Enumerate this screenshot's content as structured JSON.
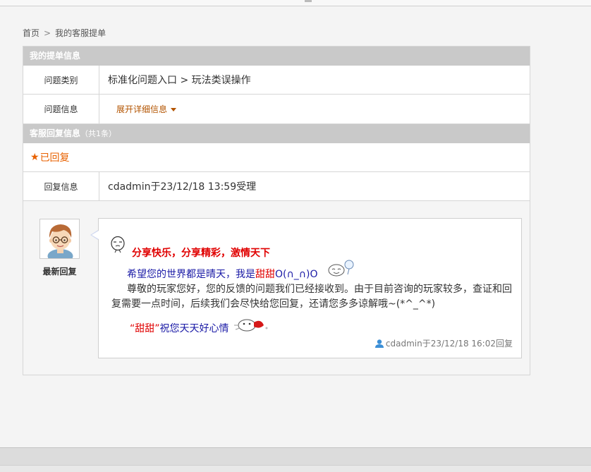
{
  "breadcrumb": {
    "home": "首页",
    "separator": ">",
    "current": "我的客服提单"
  },
  "ticket_section": {
    "title": "我的提单信息",
    "rows": [
      {
        "label": "问题类别",
        "value": "标准化问题入口 > 玩法类误操作"
      },
      {
        "label": "问题信息",
        "link": "展开详细信息"
      }
    ]
  },
  "reply_section": {
    "title": "客服回复信息",
    "count": "（共1条）",
    "status": "已回复",
    "reply_info_label": "回复信息",
    "reply_info_value": "cdadmin于23/12/18 13:59受理"
  },
  "latest_reply": {
    "avatar_label": "最新回复",
    "title": "分享快乐，分享精彩，激情天下",
    "hope_prefix": "希望您的世界都是晴天，我是",
    "hope_name": "甜甜",
    "hope_suffix": "O(∩_∩)O",
    "body": "尊敬的玩家您好，您的反馈的问题我们已经接收到。由于目前咨询的玩家较多，查证和回复需要一点时间，后续我们会尽快给您回复，还请您多多谅解哦~(*^_^*)",
    "wish_name": "“甜甜”",
    "wish_text": "祝您天天好心情",
    "meta": "cdadmin于23/12/18 16:02回复"
  },
  "colors": {
    "section_header": "#c9c9c9",
    "status_orange": "#e86100",
    "link_orange": "#b35400",
    "title_red": "#e00000",
    "text_blue": "#1a1aa6"
  }
}
